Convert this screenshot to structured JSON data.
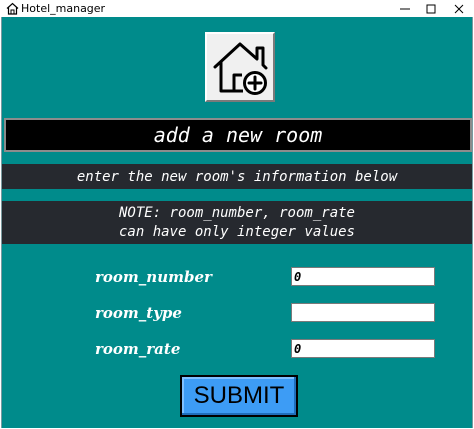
{
  "window": {
    "title": "Hotel_manager",
    "icon": "home-icon",
    "controls": [
      "minimize-icon",
      "maximize-icon",
      "close-icon"
    ]
  },
  "logo": {
    "icon": "add-home-icon"
  },
  "banner": {
    "text": "add a new room"
  },
  "instructions": {
    "text": "enter the new room's information below"
  },
  "note": {
    "line1": "NOTE: room_number, room_rate",
    "line2": "can have only integer values"
  },
  "form": {
    "fields": [
      {
        "label": "room_number",
        "value": "0"
      },
      {
        "label": "room_type",
        "value": ""
      },
      {
        "label": "room_rate",
        "value": "0"
      }
    ],
    "submit_label": "SUBMIT"
  },
  "colors": {
    "background": "#008b8b",
    "banner": "#000000",
    "info_bar": "#26292f",
    "submit": "#3d9cf5"
  }
}
